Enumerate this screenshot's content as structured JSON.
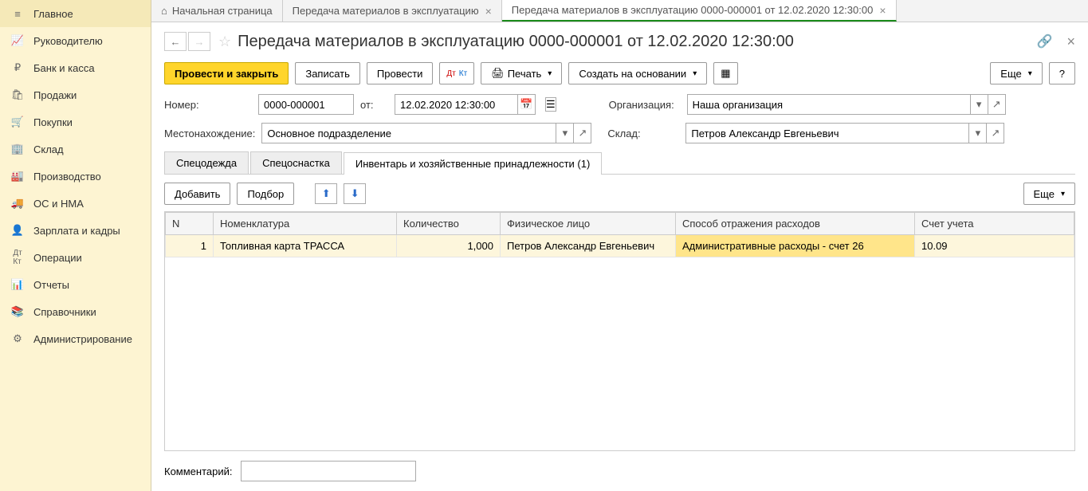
{
  "sidebar": {
    "items": [
      {
        "label": "Главное"
      },
      {
        "label": "Руководителю"
      },
      {
        "label": "Банк и касса"
      },
      {
        "label": "Продажи"
      },
      {
        "label": "Покупки"
      },
      {
        "label": "Склад"
      },
      {
        "label": "Производство"
      },
      {
        "label": "ОС и НМА"
      },
      {
        "label": "Зарплата и кадры"
      },
      {
        "label": "Операции"
      },
      {
        "label": "Отчеты"
      },
      {
        "label": "Справочники"
      },
      {
        "label": "Администрирование"
      }
    ]
  },
  "tabs": [
    {
      "label": "Начальная страница"
    },
    {
      "label": "Передача материалов в эксплуатацию"
    },
    {
      "label": "Передача материалов в эксплуатацию 0000-000001 от 12.02.2020 12:30:00"
    }
  ],
  "page": {
    "title": "Передача материалов в эксплуатацию 0000-000001 от 12.02.2020 12:30:00"
  },
  "toolbar": {
    "post_close": "Провести и закрыть",
    "save": "Записать",
    "post": "Провести",
    "print": "Печать",
    "create_based": "Создать на основании",
    "more": "Еще",
    "help": "?"
  },
  "form": {
    "number_label": "Номер:",
    "number": "0000-000001",
    "from_label": "от:",
    "date": "12.02.2020 12:30:00",
    "org_label": "Организация:",
    "org": "Наша организация",
    "location_label": "Местонахождение:",
    "location": "Основное подразделение",
    "warehouse_label": "Склад:",
    "warehouse": "Петров Александр Евгеньевич"
  },
  "sub_tabs": [
    {
      "label": "Спецодежда"
    },
    {
      "label": "Спецоснастка"
    },
    {
      "label": "Инвентарь и хозяйственные принадлежности (1)"
    }
  ],
  "table_toolbar": {
    "add": "Добавить",
    "pick": "Подбор",
    "more": "Еще"
  },
  "table": {
    "headers": {
      "n": "N",
      "item": "Номенклатура",
      "qty": "Количество",
      "person": "Физическое лицо",
      "method": "Способ отражения расходов",
      "account": "Счет учета"
    },
    "row": {
      "n": "1",
      "item": "Топливная карта ТРАССА",
      "qty": "1,000",
      "person": "Петров Александр Евгеньевич",
      "method": "Административные расходы - счет 26",
      "account": "10.09"
    }
  },
  "comment": {
    "label": "Комментарий:",
    "value": ""
  }
}
